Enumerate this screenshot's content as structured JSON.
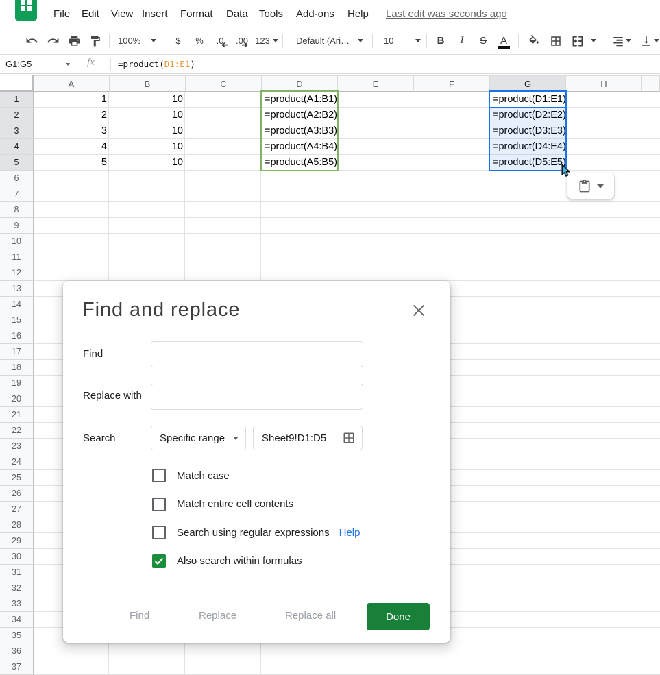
{
  "app": {
    "logo": "sheets-logo",
    "menu_items": [
      "File",
      "Edit",
      "View",
      "Insert",
      "Format",
      "Data",
      "Tools",
      "Add-ons",
      "Help"
    ],
    "last_edit": "Last edit was seconds ago"
  },
  "toolbar": {
    "undo": "undo",
    "redo": "redo",
    "print": "print",
    "paint_format": "paint-format",
    "zoom": "100%",
    "currency": "$",
    "percent": "%",
    "decrease_decimal": ".0",
    "increase_decimal": ".00",
    "more_formats": "123",
    "font_family": "Default (Ari…",
    "font_size": "10",
    "bold": "B",
    "italic": "I",
    "strikethrough": "S",
    "text_color": "A"
  },
  "formula_bar": {
    "name_box": "G1:G5",
    "fx": "fx",
    "formula_prefix": "=product(",
    "formula_range": "D1:E1",
    "formula_suffix": ")"
  },
  "grid": {
    "columns": [
      "A",
      "B",
      "C",
      "D",
      "E",
      "F",
      "G",
      "H"
    ],
    "selected_column": "G",
    "row_count": 37,
    "selected_rows": [
      1,
      2,
      3,
      4,
      5
    ],
    "cells": [
      {
        "col": "A",
        "row": 1,
        "value": "1",
        "align": "num"
      },
      {
        "col": "A",
        "row": 2,
        "value": "2",
        "align": "num"
      },
      {
        "col": "A",
        "row": 3,
        "value": "3",
        "align": "num"
      },
      {
        "col": "A",
        "row": 4,
        "value": "4",
        "align": "num"
      },
      {
        "col": "A",
        "row": 5,
        "value": "5",
        "align": "num"
      },
      {
        "col": "B",
        "row": 1,
        "value": "10",
        "align": "num"
      },
      {
        "col": "B",
        "row": 2,
        "value": "10",
        "align": "num"
      },
      {
        "col": "B",
        "row": 3,
        "value": "10",
        "align": "num"
      },
      {
        "col": "B",
        "row": 4,
        "value": "10",
        "align": "num"
      },
      {
        "col": "B",
        "row": 5,
        "value": "10",
        "align": "num"
      },
      {
        "col": "D",
        "row": 1,
        "value": "=product(A1:B1)",
        "align": "formula"
      },
      {
        "col": "D",
        "row": 2,
        "value": "=product(A2:B2)",
        "align": "formula"
      },
      {
        "col": "D",
        "row": 3,
        "value": "=product(A3:B3)",
        "align": "formula"
      },
      {
        "col": "D",
        "row": 4,
        "value": "=product(A4:B4)",
        "align": "formula"
      },
      {
        "col": "D",
        "row": 5,
        "value": "=product(A5:B5)",
        "align": "formula"
      },
      {
        "col": "G",
        "row": 1,
        "value": "=product(D1:E1)",
        "align": "formula"
      },
      {
        "col": "G",
        "row": 2,
        "value": "=product(D2:E2)",
        "align": "formula"
      },
      {
        "col": "G",
        "row": 3,
        "value": "=product(D3:E3)",
        "align": "formula"
      },
      {
        "col": "G",
        "row": 4,
        "value": "=product(D4:E4)",
        "align": "formula"
      },
      {
        "col": "G",
        "row": 5,
        "value": "=product(D5:E5)",
        "align": "formula"
      }
    ],
    "green_range": {
      "col": "D",
      "row_start": 1,
      "row_end": 5
    },
    "blue_range": {
      "col": "G",
      "row_start": 1,
      "row_end": 5,
      "active_row": 1
    }
  },
  "paste_button": {
    "icon": "clipboard"
  },
  "dialog": {
    "title": "Find and replace",
    "find_label": "Find",
    "find_value": "",
    "replace_label": "Replace with",
    "replace_value": "",
    "search_label": "Search",
    "search_value": "Specific range",
    "range_value": "Sheet9!D1:D5",
    "checkboxes": [
      {
        "label": "Match case",
        "checked": false
      },
      {
        "label": "Match entire cell contents",
        "checked": false
      },
      {
        "label": "Search using regular expressions",
        "checked": false,
        "help": "Help"
      },
      {
        "label": "Also search within formulas",
        "checked": true
      }
    ],
    "buttons": {
      "find": "Find",
      "replace": "Replace",
      "replace_all": "Replace all",
      "done": "Done"
    }
  },
  "colors": {
    "selection_blue": "#1a73e8",
    "range_green": "#84b368",
    "done_green": "#188038",
    "checkbox_green": "#1a8e3d",
    "formula_range_orange": "#e8963a",
    "link_blue": "#1a73e8"
  }
}
